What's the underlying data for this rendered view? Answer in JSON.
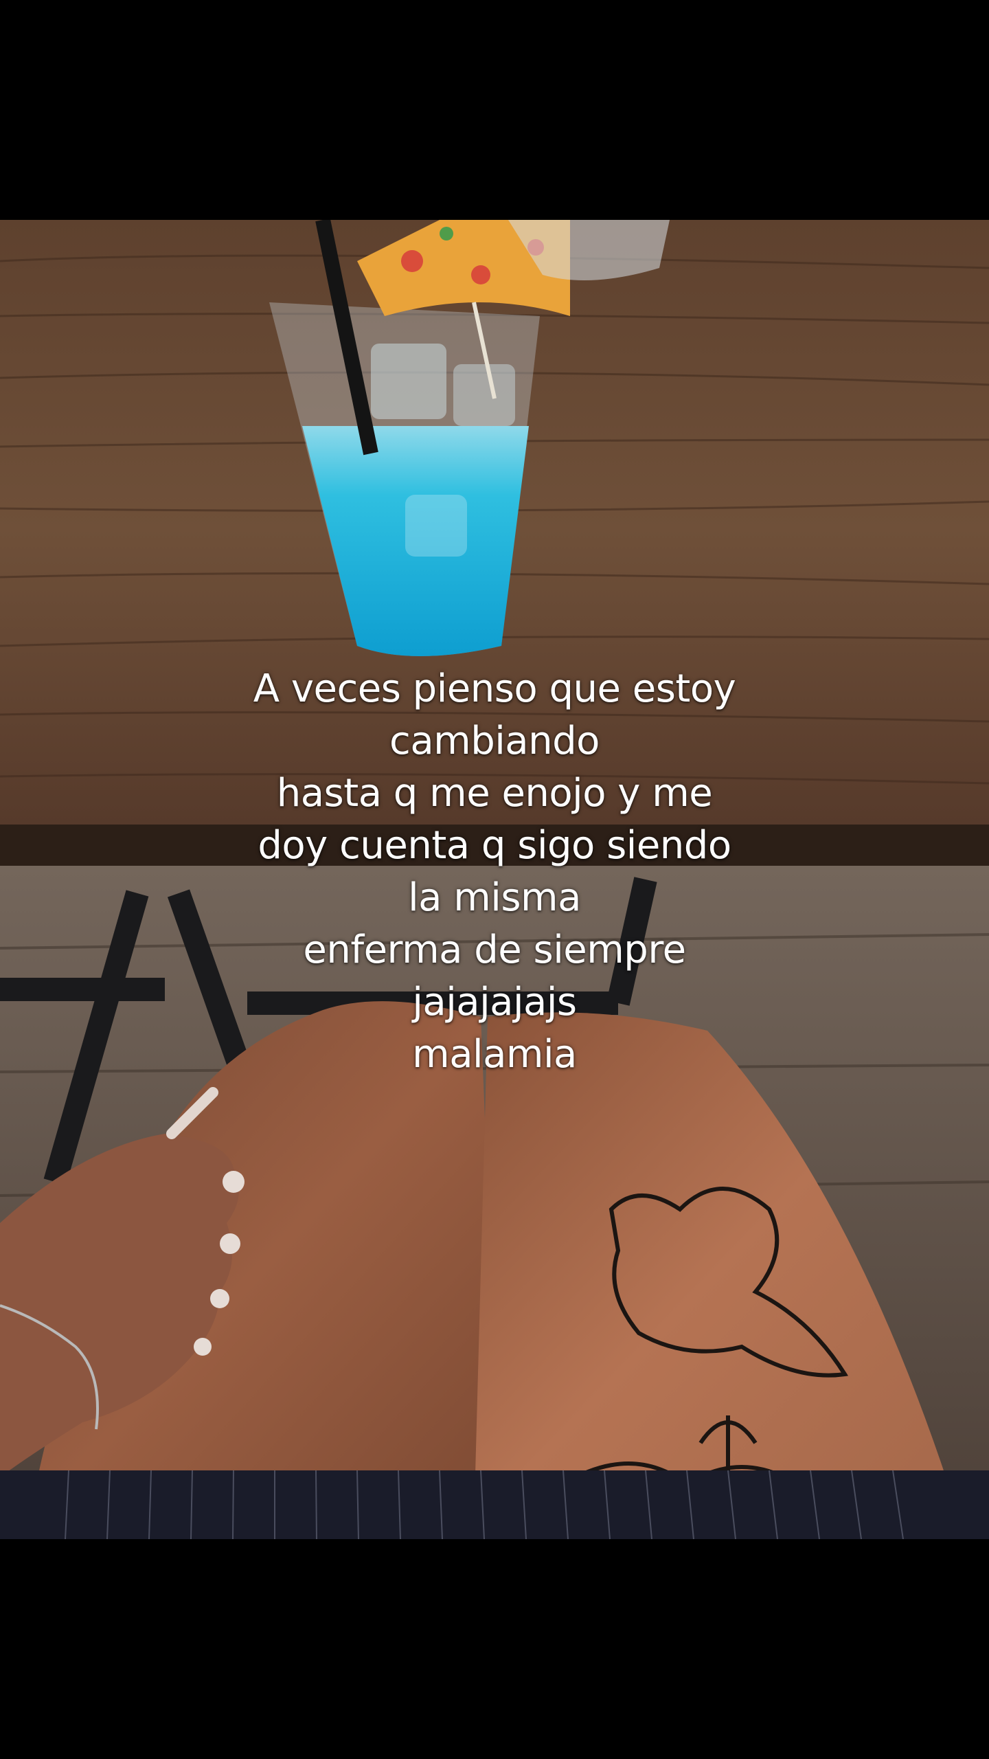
{
  "photo": {
    "icon": "table-drink-legs-photo",
    "colors": {
      "table_wood": "#6b4a34",
      "drink": "#1fb4d6",
      "floor": "#6a5a4e",
      "skin": "#a8694a",
      "skirt": "#1a1c2a",
      "umbrella": "#e9a33a"
    }
  },
  "caption": {
    "lines": [
      "A veces pienso que estoy",
      "cambiando",
      "hasta q me enojo y me",
      "doy cuenta q sigo siendo",
      "la misma",
      "enferma de siempre",
      "jajajajajs",
      "malamia"
    ]
  }
}
